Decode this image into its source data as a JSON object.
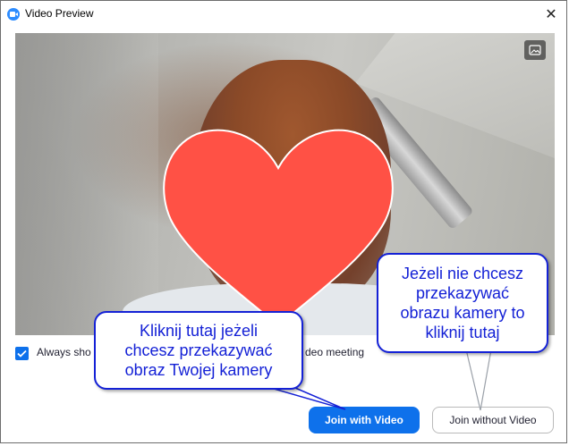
{
  "window": {
    "title": "Video Preview",
    "close_glyph": "✕"
  },
  "video": {
    "image_button_icon": "image-icon"
  },
  "options": {
    "always_show_label": "Always sho",
    "always_show_label_tail": "deo meeting",
    "checked": true
  },
  "buttons": {
    "join_with_video": "Join with Video",
    "join_without_video": "Join without Video"
  },
  "callouts": {
    "left": {
      "line1": "Kliknij tutaj jeżeli",
      "line2": "chcesz przekazywać",
      "line3": "obraz Twojej kamery"
    },
    "right": {
      "line1": "Jeżeli nie chcesz",
      "line2": "przekazywać",
      "line3": "obrazu kamery to",
      "line4": "kliknij tutaj"
    }
  },
  "colors": {
    "accent": "#0e71eb",
    "callout_text": "#1421d6",
    "heart": "#ff5145"
  }
}
